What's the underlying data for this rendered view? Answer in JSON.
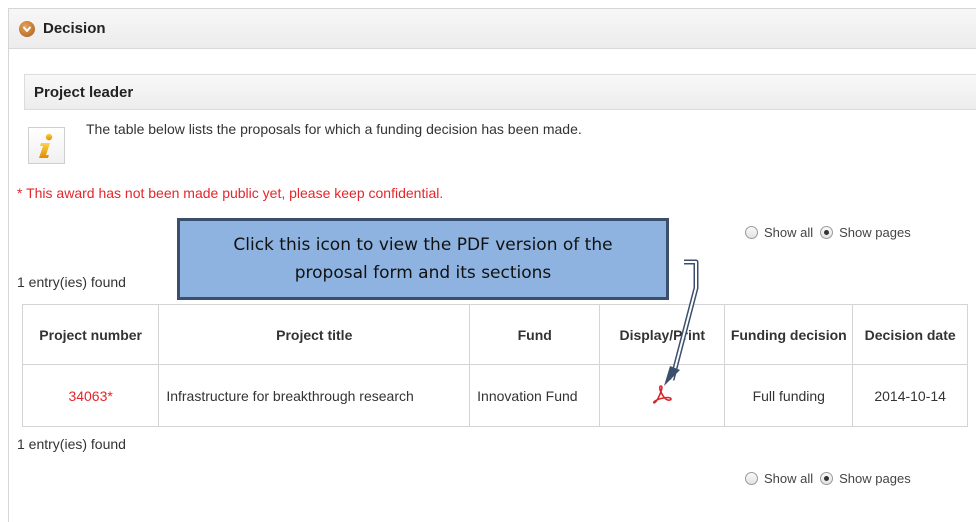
{
  "panel": {
    "title": "Decision"
  },
  "section": {
    "title": "Project leader"
  },
  "info": {
    "text": "The table below lists the proposals for which a funding decision has been made."
  },
  "notice": {
    "text": "* This award has not been made public yet, please keep confidential.",
    "color": "#e3262b"
  },
  "pagination_top": {
    "show_all": "Show all",
    "show_pages": "Show pages",
    "selected": "Show pages"
  },
  "pagination_bottom": {
    "show_all": "Show all",
    "show_pages": "Show pages",
    "selected": "Show pages"
  },
  "results": {
    "found_top": "1 entry(ies) found",
    "found_bottom": "1 entry(ies) found"
  },
  "table": {
    "headers": {
      "project_number": "Project number",
      "project_title": "Project title",
      "fund": "Fund",
      "display_print": "Display/Print",
      "funding_decision": "Funding decision",
      "decision_date": "Decision date"
    },
    "rows": [
      {
        "project_number": "34063*",
        "project_title": "Infrastructure for breakthrough research",
        "fund": "Innovation Fund",
        "display_icon": "pdf-icon",
        "funding_decision": "Full funding",
        "decision_date": "2014-10-14"
      }
    ]
  },
  "callout": {
    "text": "Click this icon to view the PDF version of the proposal form and its sections"
  },
  "icons": {
    "panel_toggle": "chevron-down-icon",
    "info": "info-icon",
    "pdf": "pdf-icon"
  },
  "colors": {
    "accent_red": "#e3262b",
    "callout_fill": "#8eb3e0",
    "callout_border": "#3b4f6c",
    "toggle_orange": "#c57a2c"
  }
}
